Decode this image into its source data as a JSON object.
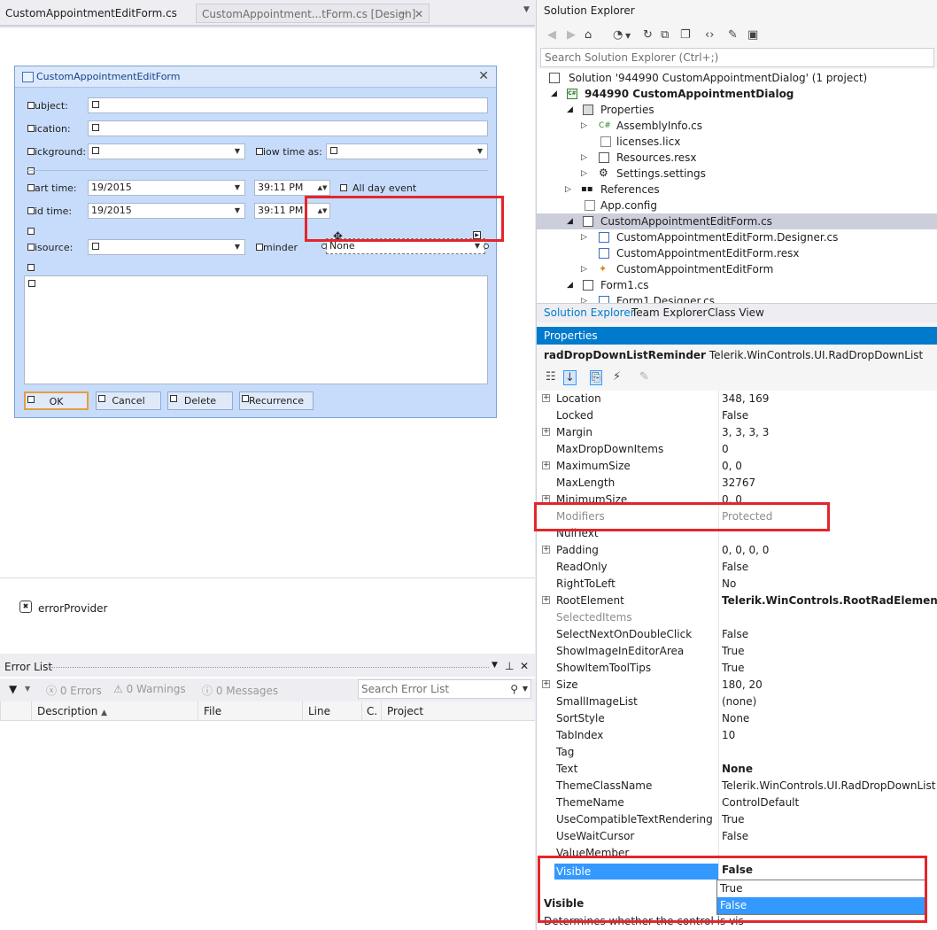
{
  "tabs": {
    "code_tab": "CustomAppointmentEditForm.cs",
    "design_tab": "CustomAppointment...tForm.cs [Design]"
  },
  "form": {
    "title": "CustomAppointmentEditForm",
    "subject_label": "ubject:",
    "location_label": "ication:",
    "background_label": "ickground:",
    "showtime_label": "iow time as:",
    "start_label": "art time:",
    "end_label": "id time:",
    "start_date": "19/2015",
    "start_time": "39:11 PM",
    "end_date": "19/2015",
    "end_time": "39:11 PM",
    "allday_label": "All day event",
    "resource_label": "isource:",
    "reminder_label": "minder",
    "reminder_value": "None",
    "buttons": {
      "ok": "OK",
      "cancel": "Cancel",
      "delete": "Delete",
      "recurrence": "Recurrence"
    }
  },
  "tray": {
    "component": "errorProvider"
  },
  "error_list": {
    "title": "Error List",
    "errors": "0 Errors",
    "warnings": "0 Warnings",
    "messages": "0 Messages",
    "search_placeholder": "Search Error List",
    "columns": [
      "Description",
      "File",
      "Line",
      "C.",
      "Project"
    ]
  },
  "solution_explorer": {
    "title": "Solution Explorer",
    "search_placeholder": "Search Solution Explorer (Ctrl+;)",
    "items": [
      {
        "label": "Solution '944990 CustomAppointmentDialog' (1 project)",
        "bold": false
      },
      {
        "label": "944990 CustomAppointmentDialog",
        "bold": true
      },
      {
        "label": "Properties"
      },
      {
        "label": "AssemblyInfo.cs"
      },
      {
        "label": "licenses.licx"
      },
      {
        "label": "Resources.resx"
      },
      {
        "label": "Settings.settings"
      },
      {
        "label": "References"
      },
      {
        "label": "App.config"
      },
      {
        "label": "CustomAppointmentEditForm.cs"
      },
      {
        "label": "CustomAppointmentEditForm.Designer.cs"
      },
      {
        "label": "CustomAppointmentEditForm.resx"
      },
      {
        "label": "CustomAppointmentEditForm"
      },
      {
        "label": "Form1.cs"
      },
      {
        "label": "Form1.Designer.cs"
      }
    ],
    "bottom_tabs": [
      "Solution Explorer",
      "Team Explorer",
      "Class View"
    ]
  },
  "properties": {
    "title": "Properties",
    "object_name": "radDropDownListReminder",
    "object_type": "Telerik.WinControls.UI.RadDropDownList",
    "rows": [
      {
        "name": "Location",
        "value": "348, 169",
        "expand": true
      },
      {
        "name": "Locked",
        "value": "False"
      },
      {
        "name": "Margin",
        "value": "3, 3, 3, 3",
        "expand": true
      },
      {
        "name": "MaxDropDownItems",
        "value": "0"
      },
      {
        "name": "MaximumSize",
        "value": "0, 0",
        "expand": true
      },
      {
        "name": "MaxLength",
        "value": "32767"
      },
      {
        "name": "MinimumSize",
        "value": "0, 0",
        "expand": true
      },
      {
        "name": "Modifiers",
        "value": "Protected",
        "dim": true
      },
      {
        "name": "NullText",
        "value": ""
      },
      {
        "name": "Padding",
        "value": "0, 0, 0, 0",
        "expand": true
      },
      {
        "name": "ReadOnly",
        "value": "False"
      },
      {
        "name": "RightToLeft",
        "value": "No"
      },
      {
        "name": "RootElement",
        "value": "Telerik.WinControls.RootRadElement",
        "expand": true,
        "bold": true
      },
      {
        "name": "SelectedItems",
        "value": "",
        "dim": true
      },
      {
        "name": "SelectNextOnDoubleClick",
        "value": "False"
      },
      {
        "name": "ShowImageInEditorArea",
        "value": "True"
      },
      {
        "name": "ShowItemToolTips",
        "value": "True"
      },
      {
        "name": "Size",
        "value": "180, 20",
        "expand": true
      },
      {
        "name": "SmallImageList",
        "value": "(none)"
      },
      {
        "name": "SortStyle",
        "value": "None"
      },
      {
        "name": "TabIndex",
        "value": "10"
      },
      {
        "name": "Tag",
        "value": ""
      },
      {
        "name": "Text",
        "value": "None",
        "bold": true
      },
      {
        "name": "ThemeClassName",
        "value": "Telerik.WinControls.UI.RadDropDownList"
      },
      {
        "name": "ThemeName",
        "value": "ControlDefault"
      },
      {
        "name": "UseCompatibleTextRendering",
        "value": "True"
      },
      {
        "name": "UseWaitCursor",
        "value": "False"
      },
      {
        "name": "ValueMember",
        "value": ""
      }
    ],
    "visible_name": "Visible",
    "visible_value": "False",
    "dropdown_options": [
      "True",
      "False"
    ],
    "desc_title": "Visible",
    "desc_text": "Determines whether the control is vis"
  },
  "colors": {
    "accent": "#007acc",
    "highlight": "#e3262b",
    "selection": "#3399ff"
  }
}
